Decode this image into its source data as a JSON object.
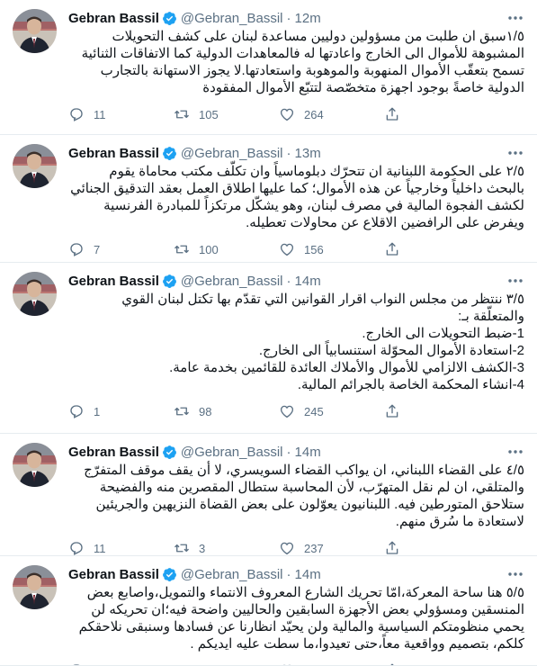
{
  "colors": {
    "accent": "#1da1f2",
    "muted": "#5b7083",
    "text": "#0f1419",
    "border": "#e6ecf0"
  },
  "tweets": [
    {
      "name": "Gebran Bassil",
      "handle": "@Gebran_Bassil",
      "separator": "·",
      "time": "12m",
      "text": "١/٥سبق ان طلبت من مسؤولين دوليين مساعدة لبنان على كشف التحويلات المشبوهة للأموال الى الخارج واعادتها له فالمعاهدات الدولية كما الاتفاقات الثنائية تسمح بتعقّب الأموال المنهوبة والموهوبة واستعادتها.لا يجوز الاستهانة بالتجارب الدولية خاصةً بوجود اجهزة متخصّصة لتتبّع الأموال المفقودة",
      "replies": "11",
      "retweets": "105",
      "likes": "264"
    },
    {
      "name": "Gebran Bassil",
      "handle": "@Gebran_Bassil",
      "separator": "·",
      "time": "13m",
      "text": "٢/٥ على الحكومة اللبنانية ان تتحرّك دبلوماسياً وان تكلّف مكتب محاماة يقوم بالبحث داخلياً وخارجياً عن هذه الأموال؛ كما عليها اطلاق العمل بعقد التدقيق الجنائي لكشف الفجوة المالية في مصرف لبنان، وهو يشكّل مرتكزاً للمبادرة الفرنسية ويفرض على الرافضين الاقلاع عن محاولات تعطيله.",
      "replies": "7",
      "retweets": "100",
      "likes": "156"
    },
    {
      "name": "Gebran Bassil",
      "handle": "@Gebran_Bassil",
      "separator": "·",
      "time": "14m",
      "text": "٣/٥ ننتظر من مجلس النواب اقرار القوانين التي تقدّم بها تكتل لبنان القوي والمتعلّقة بـ:\n1-ضبط التحويلات الى الخارج.\n2-استعادة الأموال المحوّلة استنسابياً الى الخارج.\n3-الكشف الالزامي للأموال والأملاك العائدة للقائمين بخدمة عامة.\n4-انشاء المحكمة الخاصة بالجرائم المالية.",
      "replies": "1",
      "retweets": "98",
      "likes": "245"
    },
    {
      "name": "Gebran Bassil",
      "handle": "@Gebran_Bassil",
      "separator": "·",
      "time": "14m",
      "text": "٤/٥ على القضاء اللبناني، ان يواكب القضاء السويسري، لا أن يقف موقف المتفرّج والمتلقي، ان لم نقل المتهرّب، لأن المحاسبة ستطال المقصرين منه والفضيحة ستلاحق المتورطين فيه. اللبنانيون يعوّلون على بعض القضاة النزيهين والجريئين لاستعادة ما سُرق منهم.",
      "replies": "11",
      "retweets": "3",
      "likes": "237"
    },
    {
      "name": "Gebran Bassil",
      "handle": "@Gebran_Bassil",
      "separator": "·",
      "time": "14m",
      "text": "٥/٥ هنا ساحة المعركة،امّا تحريك الشارع المعروف الانتماء والتمويل،واصابع بعض المنسقين ومسؤولي بعض الأجهزة السابقين والحاليين واضحة فيه؛ان تحريكه لن يحمي منظومتكم السياسية والمالية ولن يحيّد انظارنا عن فسادها وسنبقى نلاحقكم كلكم، بتصميم وواقعية معاً،حتى تعيدوا،ما سطت عليه ايديكم .",
      "replies": "",
      "retweets": "",
      "likes": ""
    }
  ]
}
